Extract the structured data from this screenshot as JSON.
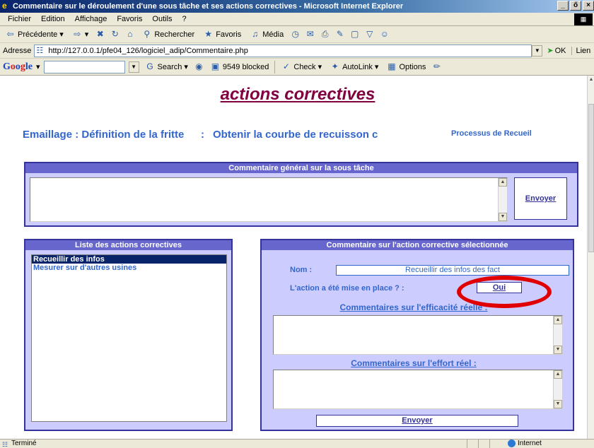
{
  "window": {
    "title": "Commentaire sur le déroulement d'une sous tâche et ses actions correctives - Microsoft Internet Explorer",
    "controls": [
      "_",
      "ő",
      "×"
    ]
  },
  "menubar": {
    "items": [
      "Fichier",
      "Edition",
      "Affichage",
      "Favoris",
      "Outils",
      "?"
    ]
  },
  "toolbar": {
    "back": "Précédente",
    "search": "Rechercher",
    "favorites": "Favoris",
    "media": "Média"
  },
  "addressbar": {
    "label": "Adresse",
    "url": "http://127.0.0.1/pfe04_126/logiciel_adip/Commentaire.php",
    "go": "OK",
    "links": "Lien"
  },
  "googlebar": {
    "search": "Search",
    "blocked": "9549 blocked",
    "check": "Check",
    "autolink": "AutoLink",
    "options": "Options"
  },
  "page": {
    "title_line2": "actions correctives",
    "crumb_task": "Emaillage : Définition de la fritte",
    "crumb_sep": ":",
    "crumb_subtask": "Obtenir la courbe de recuisson c",
    "process_link": "Processus de Recueil",
    "general_comment": {
      "header": "Commentaire général sur la sous tâche",
      "value": "",
      "send_button": "Envoyer"
    },
    "actions_list": {
      "header": "Liste des actions correctives",
      "items": [
        "Recueillir des infos",
        "Mesurer sur d'autres usines"
      ],
      "selected_index": 0
    },
    "selected_action": {
      "header": "Commentaire sur l'action corrective sélectionnée",
      "name_label": "Nom :",
      "name_value": "Recueillir des infos des fact",
      "implemented_label": "L'action a été mise en place ? :",
      "implemented_value": "Oui",
      "efficacy_label": "Commentaires sur l'efficacité réelle :",
      "effort_label": "Commentaires sur l'effort réel :",
      "send_button": "Envoyer"
    }
  },
  "statusbar": {
    "text": "Terminé",
    "zone": "Internet"
  },
  "colors": {
    "accent": "#3366cc",
    "title": "#800040",
    "panel_bg": "#ccccff",
    "panel_head": "#6666cc",
    "annotation": "#e00000"
  }
}
